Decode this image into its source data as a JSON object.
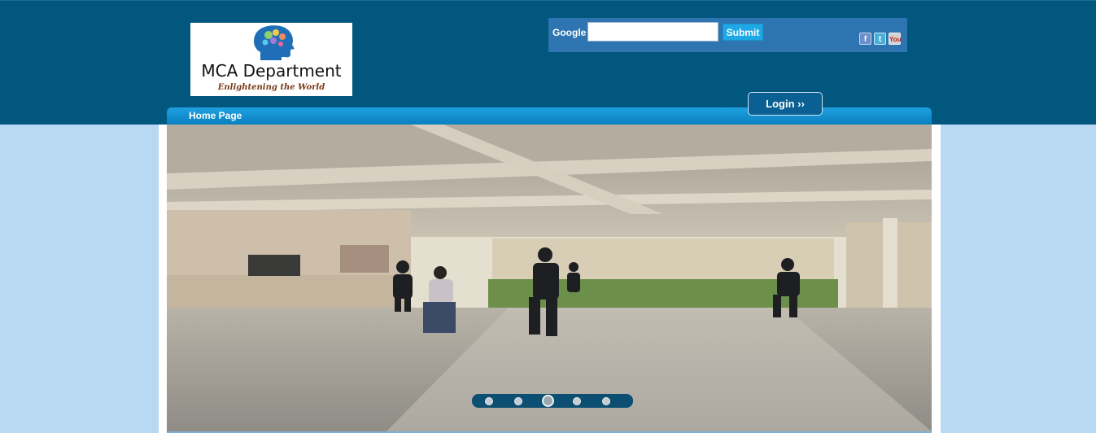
{
  "logo": {
    "title": "MCA Department",
    "tagline": "Enlightening the World"
  },
  "search": {
    "label": "Google",
    "value": "",
    "placeholder": "",
    "submit_label": "Submit"
  },
  "social": {
    "facebook_glyph": "f",
    "twitter_glyph": "t",
    "youtube_glyph": "You",
    "icons": [
      "facebook-icon",
      "twitter-icon",
      "youtube-icon"
    ]
  },
  "login": {
    "label": "Login ››"
  },
  "nav": {
    "home_label": "Home Page"
  },
  "slider": {
    "slide_count": 5,
    "active_slide": 3
  },
  "colors": {
    "header_bg": "#02577f",
    "page_bg": "#b9d8f2",
    "nav_bar": "#0a7fc0",
    "submit_button": "#1ea8e6",
    "search_panel": "#2d74b0"
  }
}
